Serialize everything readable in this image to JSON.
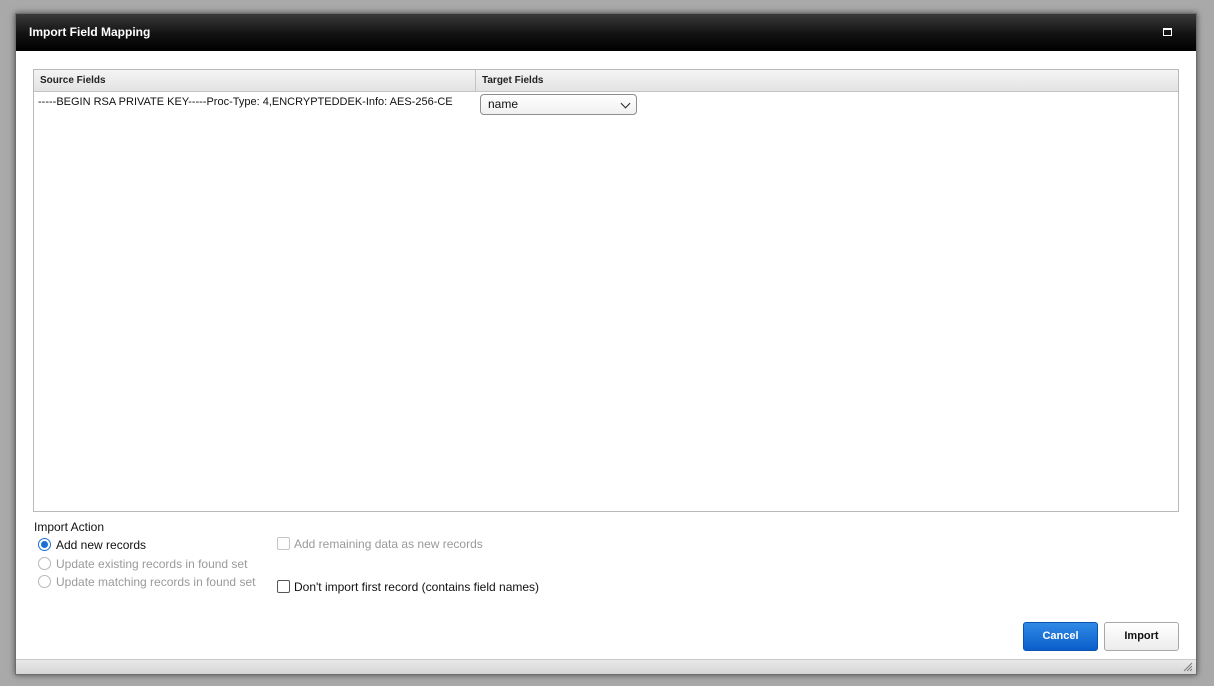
{
  "dialog": {
    "title": "Import Field Mapping"
  },
  "grid": {
    "columns": [
      "Source Fields",
      "Target Fields"
    ],
    "rows": [
      {
        "source": "-----BEGIN RSA PRIVATE KEY-----Proc-Type: 4,ENCRYPTEDDEK-Info: AES-256-CE",
        "target": "name"
      }
    ]
  },
  "import_action": {
    "label": "Import Action",
    "options": [
      {
        "label": "Add new records",
        "selected": true,
        "enabled": true
      },
      {
        "label": "Update existing records in found set",
        "selected": false,
        "enabled": false
      },
      {
        "label": "Update matching records in found set",
        "selected": false,
        "enabled": false
      }
    ],
    "add_remaining": {
      "label": "Add remaining data as new records",
      "checked": false,
      "enabled": false
    },
    "skip_first": {
      "label": "Don't import first record (contains field names)",
      "checked": false,
      "enabled": true
    }
  },
  "buttons": {
    "cancel": "Cancel",
    "import": "Import"
  },
  "colors": {
    "primary_button": "#1a6fd6",
    "titlebar": "#111111"
  }
}
